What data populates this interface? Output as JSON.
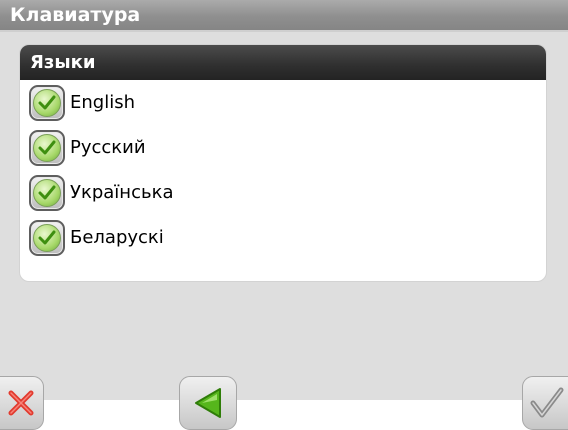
{
  "window": {
    "title": "Клавиатура"
  },
  "panel": {
    "title": "Языки"
  },
  "languages": [
    {
      "label": "English",
      "checked": true
    },
    {
      "label": "Русский",
      "checked": true
    },
    {
      "label": "Українська",
      "checked": true
    },
    {
      "label": "Беларускі",
      "checked": true
    }
  ],
  "toolbar": {
    "cancel_icon": "close-x-icon",
    "back_icon": "back-arrow-icon",
    "ok_icon": "checkmark-icon"
  },
  "colors": {
    "cancel": "#e23a2e",
    "back": "#56b61c",
    "ok": "#8a8a8a",
    "check": "#3e8f10"
  }
}
